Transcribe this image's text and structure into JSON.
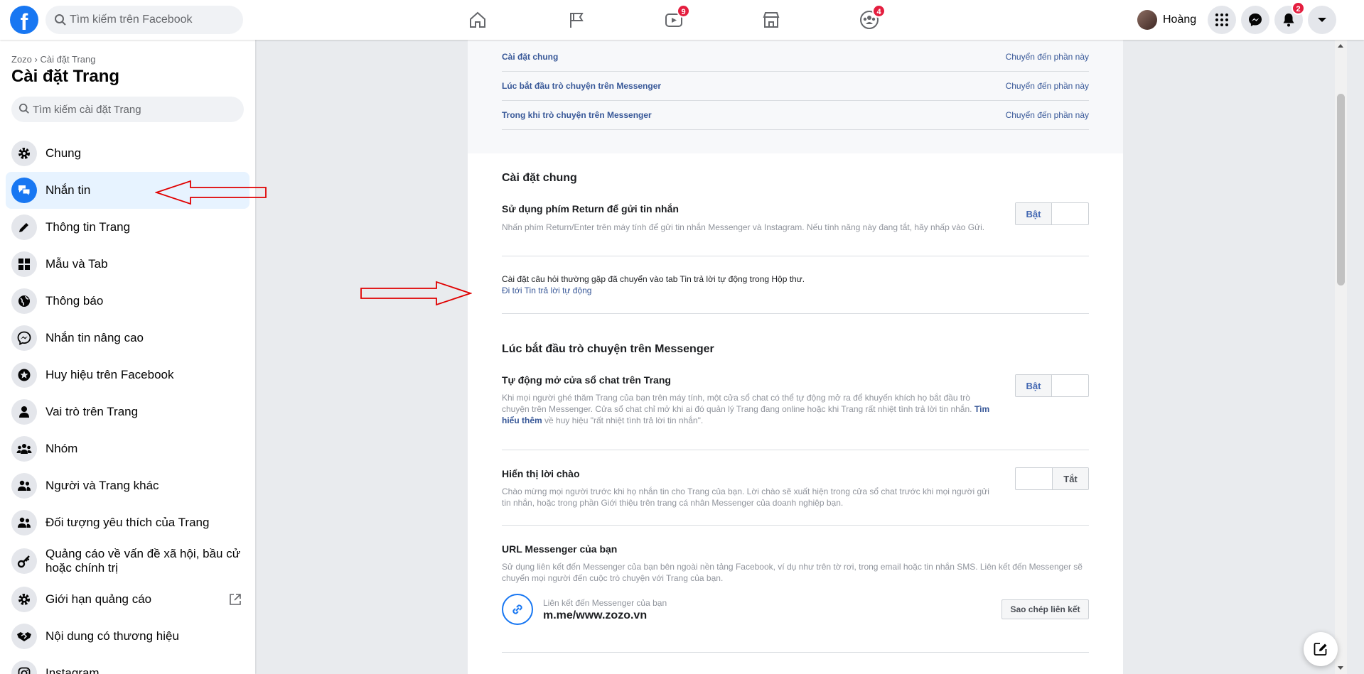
{
  "topbar": {
    "logo_letter": "f",
    "search_placeholder": "Tìm kiếm trên Facebook",
    "nav": [
      {
        "name": "home-icon",
        "badge": ""
      },
      {
        "name": "pages-flag-icon",
        "badge": ""
      },
      {
        "name": "watch-icon",
        "badge": "9"
      },
      {
        "name": "marketplace-icon",
        "badge": ""
      },
      {
        "name": "groups-icon",
        "badge": "4"
      }
    ],
    "profile_name": "Hoàng",
    "notifications_badge": "2"
  },
  "sidebar": {
    "breadcrumb": "Zozo › Cài đặt Trang",
    "title": "Cài đặt Trang",
    "search_placeholder": "Tìm kiếm cài đặt Trang",
    "items": [
      {
        "label": "Chung",
        "icon": "gear-icon"
      },
      {
        "label": "Nhắn tin",
        "icon": "chat-bubbles-icon",
        "active": true
      },
      {
        "label": "Thông tin Trang",
        "icon": "pencil-icon"
      },
      {
        "label": "Mẫu và Tab",
        "icon": "grid-icon"
      },
      {
        "label": "Thông báo",
        "icon": "globe-icon"
      },
      {
        "label": "Nhắn tin nâng cao",
        "icon": "messenger-icon"
      },
      {
        "label": "Huy hiệu trên Facebook",
        "icon": "star-badge-icon"
      },
      {
        "label": "Vai trò trên Trang",
        "icon": "person-icon"
      },
      {
        "label": "Nhóm",
        "icon": "group-icon"
      },
      {
        "label": "Người và Trang khác",
        "icon": "people-icon"
      },
      {
        "label": "Đối tượng yêu thích của Trang",
        "icon": "people-icon"
      },
      {
        "label": "Quảng cáo về vấn đề xã hội, bầu cử hoặc chính trị",
        "icon": "key-icon"
      },
      {
        "label": "Giới hạn quảng cáo",
        "icon": "gear-icon"
      },
      {
        "label": "Nội dung có thương hiệu",
        "icon": "handshake-icon"
      },
      {
        "label": "Instagram",
        "icon": "instagram-icon"
      }
    ]
  },
  "content": {
    "toc": [
      {
        "label": "Cài đặt chung",
        "action": "Chuyển đến phần này"
      },
      {
        "label": "Lúc bắt đầu trò chuyện trên Messenger",
        "action": "Chuyển đến phần này"
      },
      {
        "label": "Trong khi trò chuyện trên Messenger",
        "action": "Chuyển đến phần này"
      }
    ],
    "general": {
      "title": "Cài đặt chung",
      "return_title": "Sử dụng phím Return để gửi tin nhắn",
      "return_desc": "Nhấn phím Return/Enter trên máy tính để gửi tin nhắn Messenger và Instagram. Nếu tính năng này đang tắt, hãy nhấp vào Gửi.",
      "return_toggle": "Bật",
      "faq_note": "Cài đặt câu hỏi thường gặp đã chuyển vào tab Tin trả lời tự động trong Hộp thư.",
      "faq_link": "Đi tới Tin trả lời tự động"
    },
    "start": {
      "title": "Lúc bắt đầu trò chuyện trên Messenger",
      "auto_title": "Tự động mở cửa sổ chat trên Trang",
      "auto_desc": "Khi mọi người ghé thăm Trang của bạn trên máy tính, một cửa sổ chat có thể tự động mở ra để khuyến khích họ bắt đầu trò chuyện trên Messenger. Cửa sổ chat chỉ mở khi ai đó quản lý Trang đang online hoặc khi Trang rất nhiệt tình trả lời tin nhắn.",
      "auto_link": "Tìm hiểu thêm",
      "auto_desc_end": "về huy hiệu \"rất nhiệt tình trả lời tin nhắn\".",
      "auto_toggle": "Bật",
      "greeting_title": "Hiển thị lời chào",
      "greeting_desc": "Chào mừng mọi người trước khi họ nhắn tin cho Trang của bạn. Lời chào sẽ xuất hiện trong cửa sổ chat trước khi mọi người gửi tin nhắn, hoặc trong phần Giới thiệu trên trang cá nhân Messenger của doanh nghiệp bạn.",
      "greeting_toggle": "Tắt",
      "url_title": "URL Messenger của bạn",
      "url_desc": "Sử dụng liên kết đến Messenger của bạn bên ngoài nền tảng Facebook, ví dụ như trên tờ rơi, trong email hoặc tin nhắn SMS. Liên kết đến Messenger sẽ chuyển mọi người đến cuộc trò chuyện với Trang của bạn.",
      "link_label": "Liên kết đến Messenger của bạn",
      "link_url": "m.me/www.zozo.vn",
      "copy_button": "Sao chép liên kết"
    }
  },
  "colors": {
    "brand": "#1877f2",
    "badge": "#e41e3f",
    "annotation_arrow": "#e00000"
  }
}
